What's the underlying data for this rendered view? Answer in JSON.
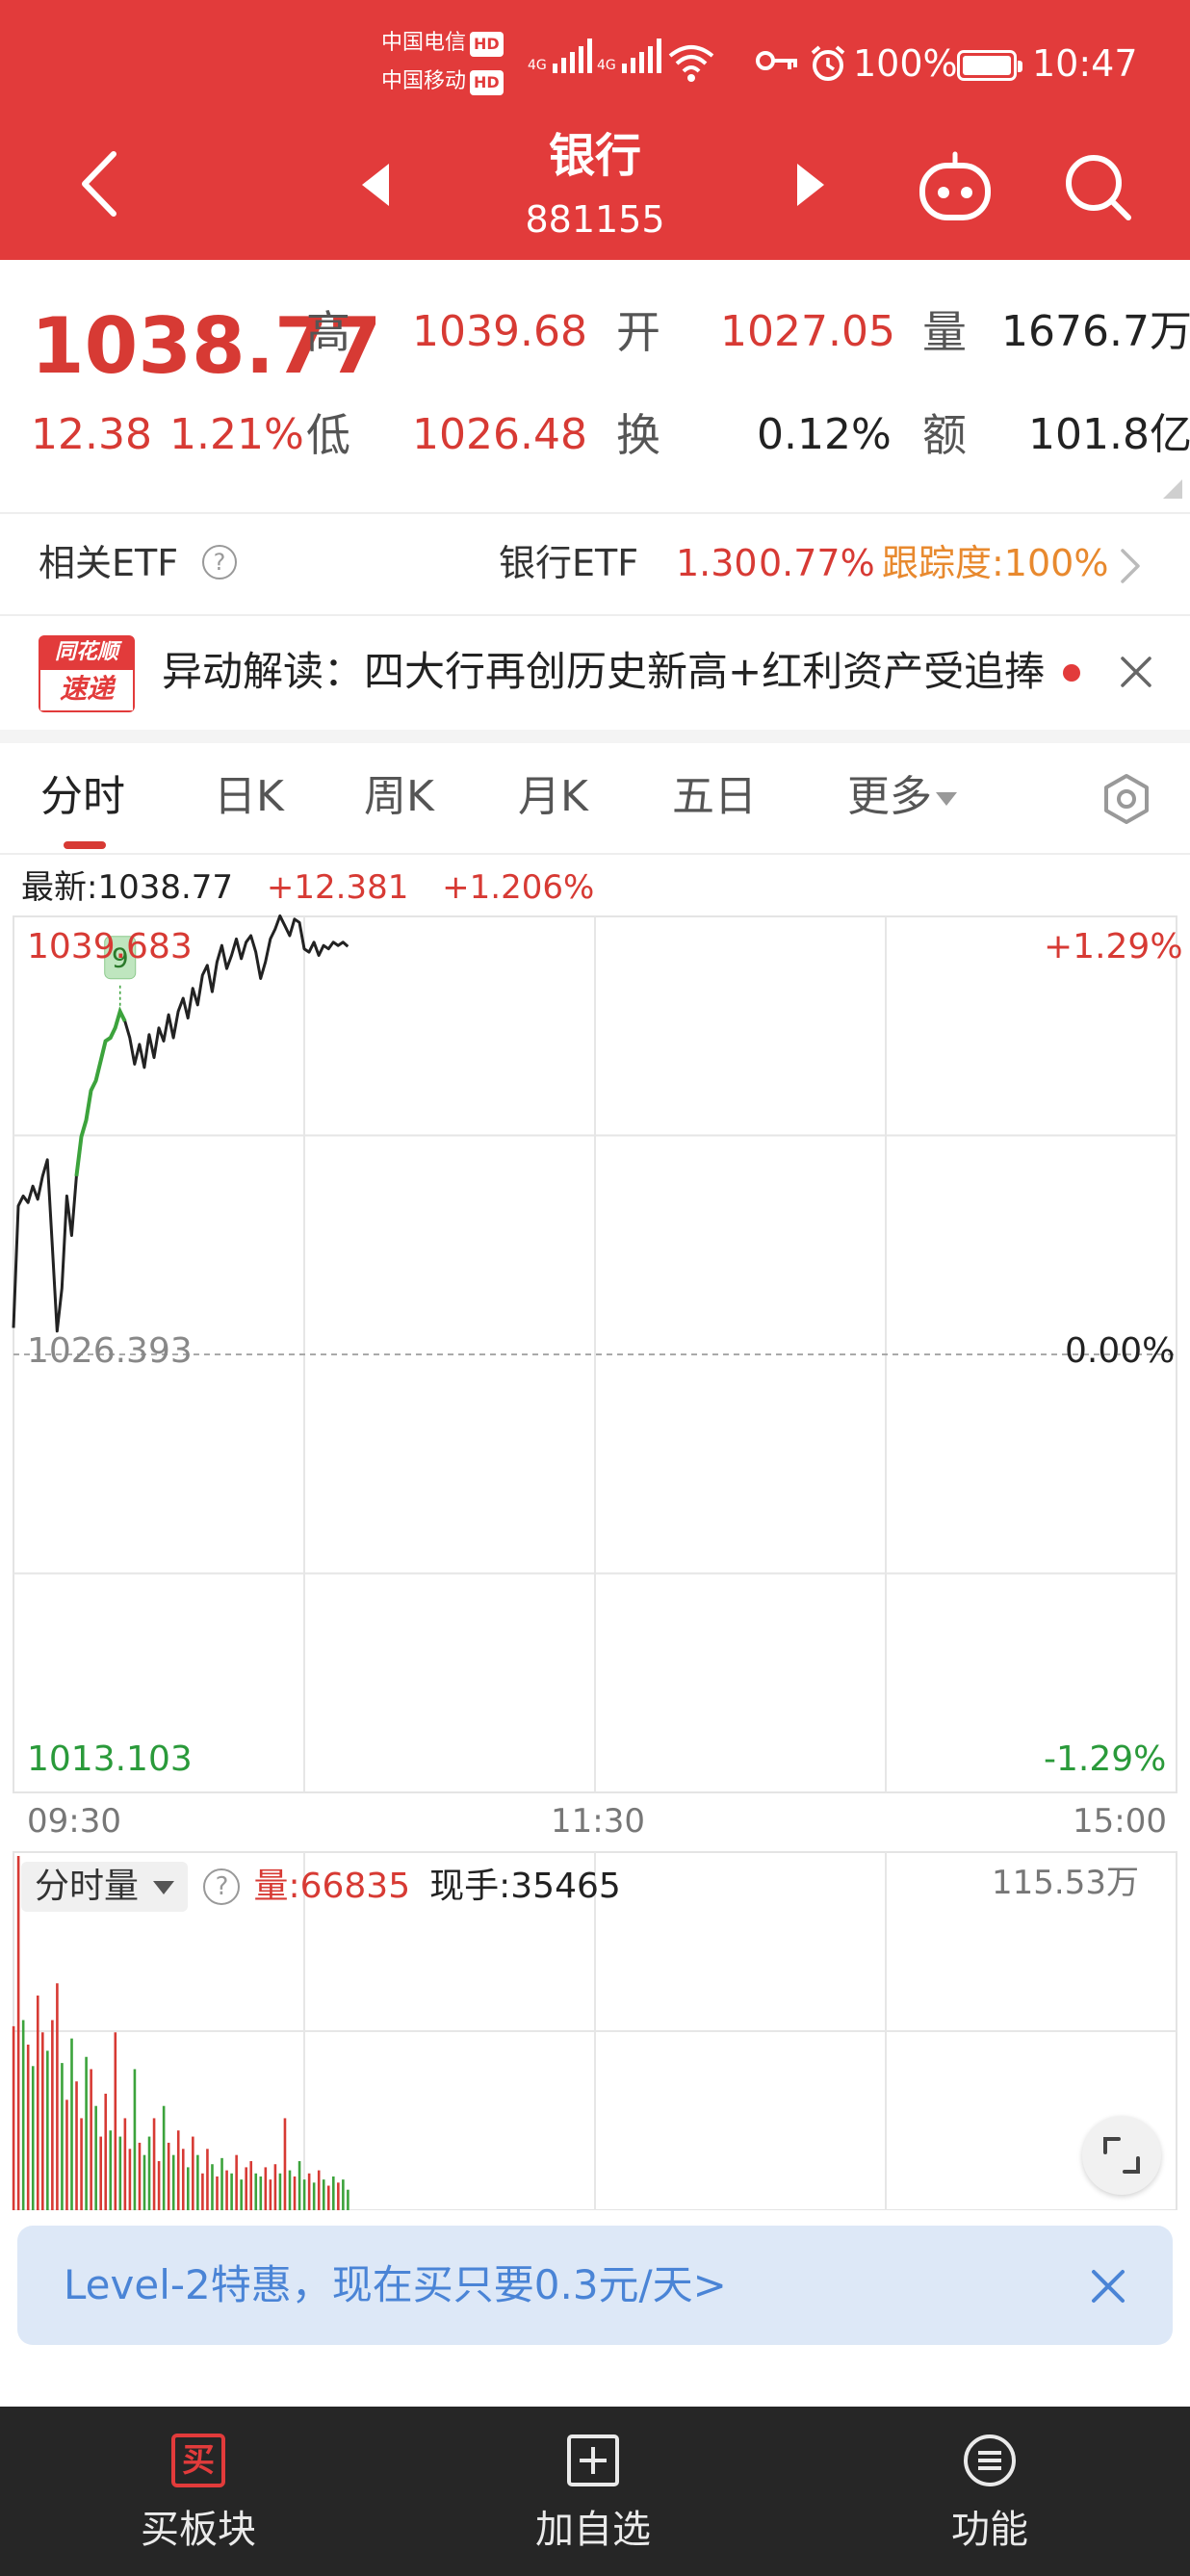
{
  "status_bar": {
    "carrier1": "中国电信",
    "carrier2": "中国移动",
    "hd_badge": "HD",
    "net1": "4G",
    "net2": "4G",
    "wifi_label": "6",
    "battery": "100%",
    "time": "10:47"
  },
  "header": {
    "title": "银行",
    "code": "881155"
  },
  "quote": {
    "price": "1038.77",
    "change": "12.38",
    "change_pct": "1.21%",
    "high_label": "高",
    "high": "1039.68",
    "low_label": "低",
    "low": "1026.48",
    "open_label": "开",
    "open": "1027.05",
    "turnover_label": "换",
    "turnover": "0.12%",
    "volume_label": "量",
    "volume": "1676.7万",
    "amount_label": "额",
    "amount": "101.8亿"
  },
  "etf": {
    "label": "相关ETF",
    "help": "?",
    "name": "银行ETF",
    "price": "1.30",
    "change_pct": "0.77%",
    "tracking": "跟踪度:100%"
  },
  "news": {
    "logo_top": "同花顺",
    "logo_bottom": "速递",
    "text": "异动解读：四大行再创历史新高+红利资产受追捧"
  },
  "tabs": [
    {
      "label": "分时"
    },
    {
      "label": "日K"
    },
    {
      "label": "周K"
    },
    {
      "label": "月K"
    },
    {
      "label": "五日"
    },
    {
      "label": "更多"
    }
  ],
  "chart_info": {
    "latest": "最新:1038.77",
    "change": "+12.381",
    "change_pct": "+1.206%"
  },
  "chart_data": {
    "type": "line",
    "y_max_label": "1039.683",
    "y_mid_label": "1026.393",
    "y_min_label": "1013.103",
    "pct_max_label": "+1.29%",
    "pct_mid_label": "0.00%",
    "pct_min_label": "-1.29%",
    "x_labels": [
      "09:30",
      "11:30",
      "15:00"
    ],
    "ylim": [
      1013.103,
      1039.683
    ],
    "prev_close": 1026.393,
    "marker_label": "9",
    "marker_index": 22,
    "green_range": [
      13,
      23
    ],
    "price": [
      1027.2,
      1030.9,
      1031.2,
      1031.0,
      1031.5,
      1031.1,
      1031.8,
      1032.3,
      1029.7,
      1027.1,
      1028.4,
      1031.2,
      1030.0,
      1031.8,
      1033.0,
      1033.5,
      1034.4,
      1034.7,
      1035.3,
      1035.9,
      1036.0,
      1036.3,
      1036.8,
      1036.5,
      1036.0,
      1035.2,
      1035.8,
      1035.1,
      1036.1,
      1035.4,
      1036.3,
      1035.9,
      1036.7,
      1036.0,
      1036.8,
      1037.2,
      1036.6,
      1037.5,
      1037.0,
      1037.9,
      1038.2,
      1037.4,
      1038.3,
      1038.8,
      1038.1,
      1038.5,
      1039.0,
      1038.4,
      1038.9,
      1039.1,
      1038.6,
      1037.8,
      1038.3,
      1039.0,
      1039.3,
      1039.7,
      1039.4,
      1039.1,
      1039.6,
      1039.5,
      1038.7,
      1038.6,
      1038.9,
      1038.5,
      1038.8,
      1038.7,
      1038.9,
      1038.8,
      1038.9,
      1038.77
    ],
    "volume_label": "分时量",
    "volume_current": "量:66835",
    "volume_hand": "现手:35465",
    "volume_max_label": "115.53万",
    "volume_max": 1155300,
    "volume": [
      600000,
      1155300,
      620000,
      540000,
      470000,
      700000,
      580000,
      520000,
      620000,
      740000,
      480000,
      360000,
      560000,
      420000,
      300000,
      500000,
      460000,
      340000,
      240000,
      380000,
      260000,
      580000,
      240000,
      300000,
      200000,
      460000,
      220000,
      180000,
      240000,
      300000,
      160000,
      340000,
      220000,
      180000,
      260000,
      200000,
      140000,
      240000,
      180000,
      120000,
      200000,
      150000,
      110000,
      170000,
      130000,
      120000,
      180000,
      100000,
      140000,
      160000,
      120000,
      110000,
      140000,
      100000,
      150000,
      120000,
      300000,
      130000,
      110000,
      160000,
      100000,
      120000,
      90000,
      130000,
      100000,
      80000,
      110000,
      90000,
      100000,
      66835
    ],
    "volume_up": [
      true,
      true,
      false,
      true,
      false,
      true,
      true,
      false,
      true,
      true,
      false,
      true,
      false,
      true,
      true,
      false,
      true,
      false,
      true,
      true,
      false,
      true,
      false,
      true,
      true,
      false,
      true,
      false,
      false,
      true,
      true,
      false,
      true,
      false,
      true,
      true,
      false,
      true,
      false,
      true,
      true,
      false,
      true,
      false,
      true,
      false,
      true,
      false,
      true,
      true,
      false,
      false,
      true,
      true,
      true,
      false,
      true,
      false,
      true,
      false,
      false,
      true,
      false,
      true,
      false,
      true,
      false,
      true,
      false,
      false
    ]
  },
  "promo": {
    "text": "Level-2特惠，现在买只要0.3元/天>"
  },
  "bottom_bar": {
    "buy_label": "买板块",
    "buy_icon_text": "买",
    "watch_label": "加自选",
    "func_label": "功能"
  }
}
